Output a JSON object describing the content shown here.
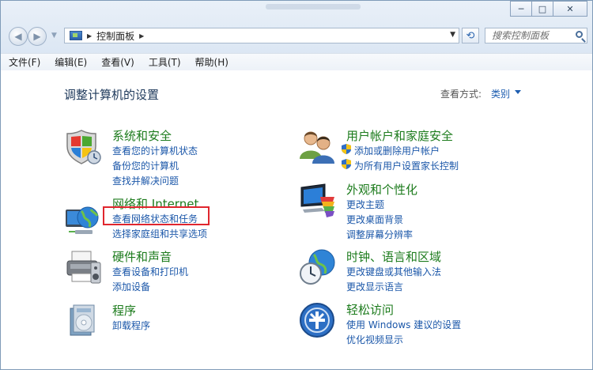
{
  "window": {
    "minimize": "─",
    "maximize": "□",
    "close": "✕"
  },
  "address": {
    "crumb": "控制面板"
  },
  "search": {
    "placeholder": "搜索控制面板"
  },
  "menu": [
    "文件(F)",
    "编辑(E)",
    "查看(V)",
    "工具(T)",
    "帮助(H)"
  ],
  "page": {
    "title": "调整计算机的设置",
    "view_by_label": "查看方式:",
    "view_by_value": "类别"
  },
  "categories": [
    {
      "title": "系统和安全",
      "icon": "shield-windows-icon",
      "links": [
        "查看您的计算机状态",
        "备份您的计算机",
        "查找并解决问题"
      ]
    },
    {
      "title": "网络和 Internet",
      "icon": "network-globe-icon",
      "links": [
        "查看网络状态和任务",
        "选择家庭组和共享选项"
      ]
    },
    {
      "title": "硬件和声音",
      "icon": "printer-icon",
      "links": [
        "查看设备和打印机",
        "添加设备"
      ]
    },
    {
      "title": "程序",
      "icon": "programs-icon",
      "links": [
        "卸载程序"
      ]
    },
    {
      "title": "用户帐户和家庭安全",
      "icon": "users-icon",
      "links": [
        "添加或删除用户帐户",
        "为所有用户设置家长控制"
      ]
    },
    {
      "title": "外观和个性化",
      "icon": "appearance-monitor-icon",
      "links": [
        "更改主题",
        "更改桌面背景",
        "调整屏幕分辨率"
      ]
    },
    {
      "title": "时钟、语言和区域",
      "icon": "clock-globe-icon",
      "links": [
        "更改键盘或其他输入法",
        "更改显示语言"
      ]
    },
    {
      "title": "轻松访问",
      "icon": "ease-of-access-icon",
      "links": [
        "使用 Windows 建议的设置",
        "优化视频显示"
      ]
    }
  ]
}
